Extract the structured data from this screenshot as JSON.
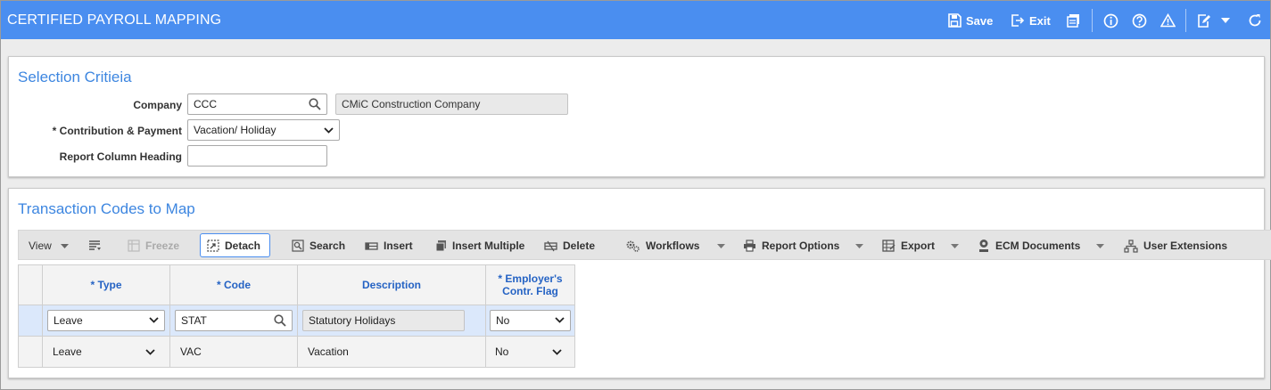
{
  "header": {
    "title": "CERTIFIED PAYROLL MAPPING",
    "save_label": "Save",
    "exit_label": "Exit",
    "accent": "#4a8ef0"
  },
  "selection": {
    "title": "Selection Critieia",
    "company_label": "Company",
    "company_value": "CCC",
    "company_name": "CMiC Construction Company",
    "contribution_label": "* Contribution & Payment",
    "contribution_value": "Vacation/ Holiday",
    "report_heading_label": "Report Column Heading",
    "report_heading_value": ""
  },
  "transactions": {
    "title": "Transaction Codes to Map",
    "toolbar": {
      "view": "View",
      "freeze": "Freeze",
      "detach": "Detach",
      "search": "Search",
      "insert": "Insert",
      "insert_multiple": "Insert Multiple",
      "delete": "Delete",
      "workflows": "Workflows",
      "report_options": "Report Options",
      "export": "Export",
      "ecm_documents": "ECM Documents",
      "user_extensions": "User Extensions"
    },
    "columns": {
      "type": "* Type",
      "code": "* Code",
      "description": "Description",
      "flag_line1": "* Employer's",
      "flag_line2": "Contr. Flag"
    },
    "rows": [
      {
        "type": "Leave",
        "code": "STAT",
        "description": "Statutory Holidays",
        "flag": "No"
      },
      {
        "type": "Leave",
        "code": "VAC",
        "description": "Vacation",
        "flag": "No"
      }
    ]
  }
}
